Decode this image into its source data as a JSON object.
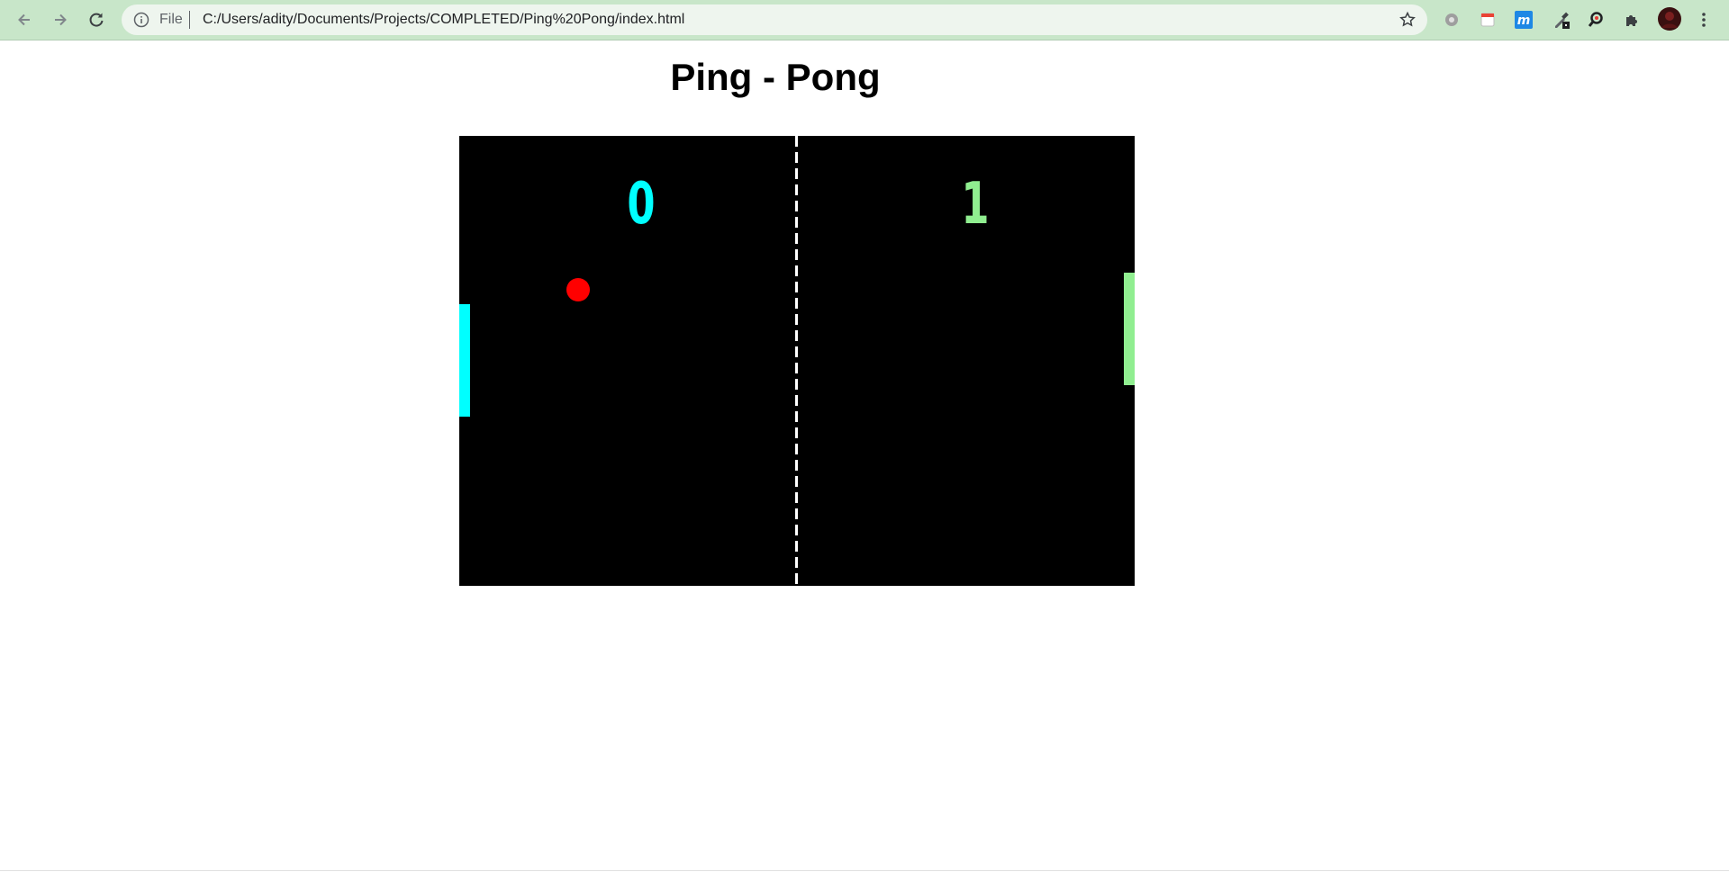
{
  "browser": {
    "address_scheme": "File",
    "address_url": "C:/Users/adity/Documents/Projects/COMPLETED/Ping%20Pong/index.html",
    "chrome_color": "#c8e6c9"
  },
  "page": {
    "title": "Ping - Pong"
  },
  "game": {
    "background_color": "#000000",
    "net_color": "#ffffff",
    "left_player": {
      "score": "0",
      "color": "#00ffff"
    },
    "right_player": {
      "score": "1",
      "color": "#90ee90"
    },
    "ball": {
      "color": "#ff0000"
    }
  }
}
